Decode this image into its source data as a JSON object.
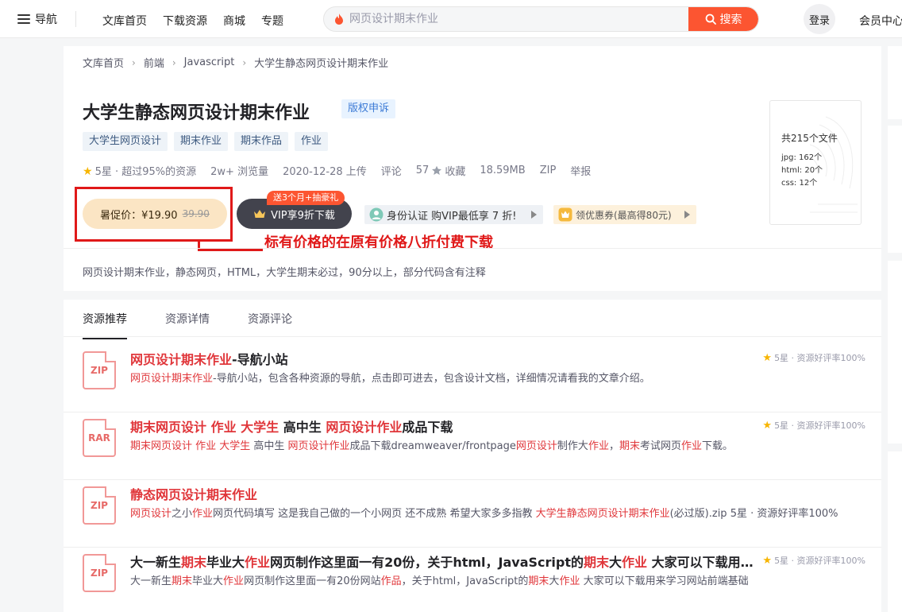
{
  "topnav": {
    "menu_label": "导航",
    "links": [
      "文库首页",
      "下载资源",
      "商城",
      "专题"
    ],
    "search_placeholder": "网页设计期末作业",
    "search_button": "搜索",
    "login": "登录",
    "vip_center": "会员中心"
  },
  "breadcrumb": [
    "文库首页",
    "前端",
    "Javascript",
    "大学生静态网页设计期末作业"
  ],
  "resource": {
    "title": "大学生静态网页设计期末作业",
    "copyright_tag": "版权申诉",
    "tags": [
      "大学生网页设计",
      "期末作业",
      "期末作品",
      "作业"
    ],
    "meta": {
      "rating": "5星 · 超过95%的资源",
      "views": "2w+ 浏览量",
      "date": "2020-12-28 上传",
      "comment": "评论",
      "collect_count": "57",
      "collect": "收藏",
      "size": "18.59MB",
      "format": "ZIP",
      "report": "举报"
    },
    "price": {
      "label": "暑促价：¥19.90",
      "original": "39.90"
    },
    "vip_badge": "送3个月+抽豪礼",
    "vip_button": "VIP享9折下载",
    "cert_button": "身份认证 购VIP最低享 7 折!",
    "coupon_button": "领优惠券(最高得80元)",
    "annotation": "标有价格的在原有价格八折付费下载",
    "files": {
      "total": "共215个文件",
      "list": [
        "jpg: 162个",
        "html: 20个",
        "css: 12个"
      ]
    },
    "description": "网页设计期末作业，静态网页，HTML，大学生期末必过，90分以上，部分代码含有注释"
  },
  "tabs": [
    "资源推荐",
    "资源详情",
    "资源评论"
  ],
  "recommendations": [
    {
      "icon": "ZIP",
      "title": [
        {
          "t": "网页设计期末作业",
          "hl": true
        },
        {
          "t": "-导航小站",
          "hl": false
        }
      ],
      "desc": [
        {
          "t": "网页设计期末作业",
          "hl": true
        },
        {
          "t": "-导航小站，包含各种资源的导航，点击即可进去，包含设计文档，详细情况请看我的文章介绍。",
          "hl": false
        }
      ],
      "rating": "5星 · 资源好评率100%"
    },
    {
      "icon": "RAR",
      "title": [
        {
          "t": "期末网页设计 作业 大学生",
          "hl": true
        },
        {
          "t": " 高中生 ",
          "hl": false
        },
        {
          "t": "网页设计作业",
          "hl": true
        },
        {
          "t": "成品下载",
          "hl": false
        }
      ],
      "desc": [
        {
          "t": "期末网页设计 作业 大学生",
          "hl": true
        },
        {
          "t": " 高中生 ",
          "hl": false
        },
        {
          "t": "网页设计作业",
          "hl": true
        },
        {
          "t": "成品下载dreamweaver/frontpage",
          "hl": false
        },
        {
          "t": "网页设计",
          "hl": true
        },
        {
          "t": "制作大",
          "hl": false
        },
        {
          "t": "作业",
          "hl": true
        },
        {
          "t": "，",
          "hl": false
        },
        {
          "t": "期末",
          "hl": true
        },
        {
          "t": "考试网页",
          "hl": false
        },
        {
          "t": "作业",
          "hl": true
        },
        {
          "t": "下载。",
          "hl": false
        }
      ],
      "rating": "5星 · 资源好评率100%"
    },
    {
      "icon": "ZIP",
      "title": [
        {
          "t": "静态网页设计期末作业",
          "hl": true
        }
      ],
      "desc": [
        {
          "t": "网页设计",
          "hl": true
        },
        {
          "t": "之小",
          "hl": false
        },
        {
          "t": "作业",
          "hl": true
        },
        {
          "t": "网页代码填写 这是我自己做的一个小网页 还不成熟 希望大家多多指教 ",
          "hl": false
        },
        {
          "t": "大学生静态网页设计期末作业",
          "hl": true
        },
        {
          "t": "(必过版).zip 5星 · 资源好评率100%",
          "hl": false
        }
      ],
      "rating": ""
    },
    {
      "icon": "ZIP",
      "title": [
        {
          "t": "大一新生",
          "hl": false
        },
        {
          "t": "期末",
          "hl": true
        },
        {
          "t": "毕业大",
          "hl": false
        },
        {
          "t": "作业",
          "hl": true
        },
        {
          "t": "网页制作这里面一有20份，关于html，JavaScript的",
          "hl": false
        },
        {
          "t": "期末",
          "hl": true
        },
        {
          "t": "大",
          "hl": false
        },
        {
          "t": "作业",
          "hl": true
        },
        {
          "t": " 大家可以下载用来学习网站前端基础",
          "hl": false
        }
      ],
      "desc": [
        {
          "t": "大一新生",
          "hl": false
        },
        {
          "t": "期末",
          "hl": true
        },
        {
          "t": "毕业大",
          "hl": false
        },
        {
          "t": "作业",
          "hl": true
        },
        {
          "t": "网页制作这里面一有20份网站",
          "hl": false
        },
        {
          "t": "作品",
          "hl": true
        },
        {
          "t": "，关于html，JavaScript的",
          "hl": false
        },
        {
          "t": "期末",
          "hl": true
        },
        {
          "t": "大",
          "hl": false
        },
        {
          "t": "作业",
          "hl": true
        },
        {
          "t": " 大家可以下载用来学习网站前端基础",
          "hl": false
        }
      ],
      "rating": "5星 · 资源好评率100%"
    }
  ]
}
